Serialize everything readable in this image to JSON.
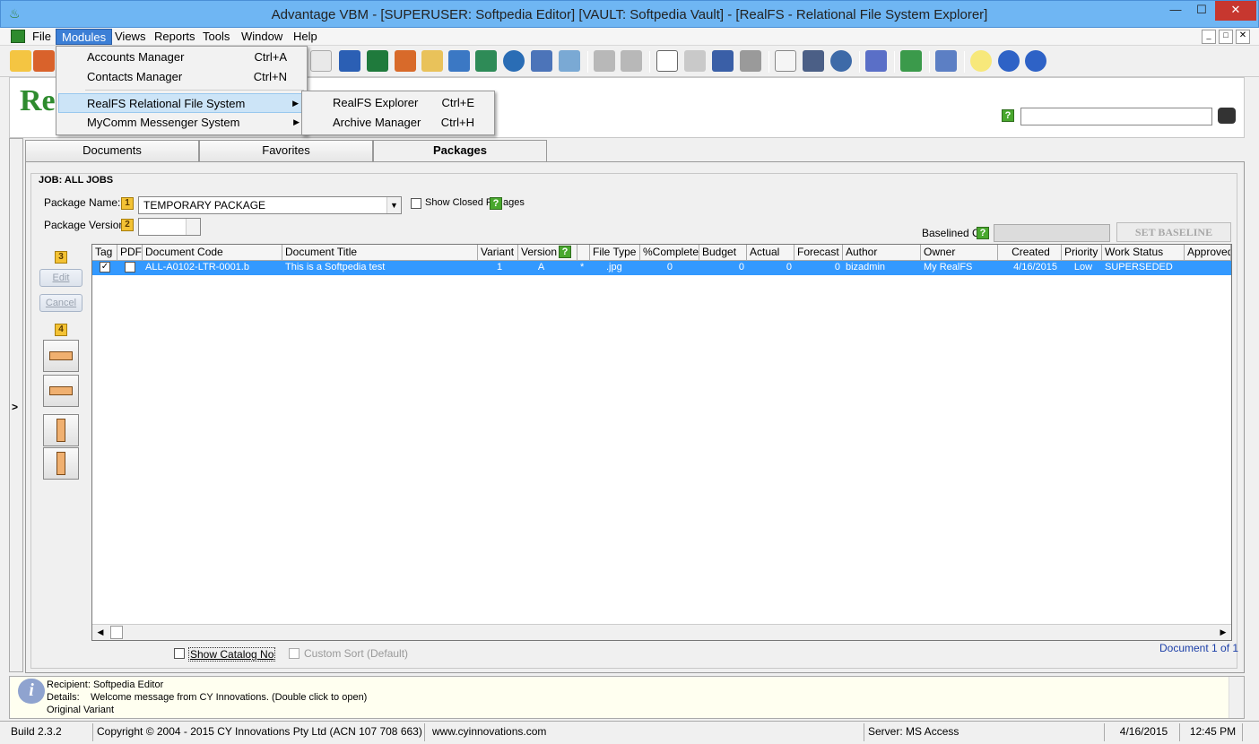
{
  "window": {
    "title": "Advantage VBM - [SUPERUSER: Softpedia Editor]  [VAULT: Softpedia Vault] - [RealFS - Relational File System Explorer]",
    "minimize": "—",
    "maximize": "☐",
    "close": "✕"
  },
  "menubar": [
    "File",
    "Modules",
    "Views",
    "Reports",
    "Tools",
    "Window",
    "Help"
  ],
  "modules_menu": {
    "items": [
      {
        "label": "Accounts Manager",
        "shortcut": "Ctrl+A"
      },
      {
        "label": "Contacts Manager",
        "shortcut": "Ctrl+N"
      },
      {
        "label": "RealFS Relational File System",
        "shortcut": ""
      },
      {
        "label": "MyComm Messenger System",
        "shortcut": ""
      }
    ]
  },
  "realfs_submenu": {
    "items": [
      {
        "label": "RealFS Explorer",
        "shortcut": "Ctrl+E"
      },
      {
        "label": "Archive Manager",
        "shortcut": "Ctrl+H"
      }
    ]
  },
  "header": {
    "logo": "Re",
    "search_value": ""
  },
  "tabs": [
    "Documents",
    "Favorites",
    "Packages"
  ],
  "job_label": "JOB: ALL JOBS",
  "package": {
    "name_label": "Package Name:",
    "name_value": "TEMPORARY PACKAGE",
    "version_label": "Package Version",
    "show_closed_a": "Show Closed P",
    "show_closed_b": "ages",
    "baselined_label": "Baselined C",
    "set_baseline": "SET BASELINE"
  },
  "markers": {
    "m1": "1",
    "m2": "2",
    "m3": "3",
    "m4": "4"
  },
  "side_buttons": {
    "edit": "Edit",
    "cancel": "Cancel"
  },
  "grid": {
    "headers": [
      "Tag",
      "PDF",
      "Document Code",
      "Document Title",
      "Variant",
      "Version",
      "",
      "File Type",
      "%Complete",
      "Budget",
      "Actual",
      "Forecast",
      "Author",
      "Owner",
      "Created",
      "Priority",
      "Work Status",
      "Approved"
    ],
    "row": [
      "",
      "",
      "ALL-A0102-LTR-0001.b",
      "This is a Softpedia test",
      "1",
      "A",
      "*",
      ".jpg",
      "0",
      "0",
      "0",
      "0",
      "bizadmin",
      "My RealFS",
      "4/16/2015",
      "Low",
      "SUPERSEDED",
      ""
    ]
  },
  "footer": {
    "show_catalog": "Show Catalog No",
    "custom_sort": "Custom Sort (Default)",
    "doc_count": "Document 1 of 1"
  },
  "message": {
    "line1": "Recipient: Softpedia Editor",
    "line2_label": "Details:",
    "line2_value": "Welcome message from CY Innovations. (Double click to open)",
    "line3": "Original Variant"
  },
  "status": {
    "build": "Build 2.3.2",
    "copyright": "Copyright © 2004 - 2015 CY Innovations Pty Ltd  (ACN 107 708 663)",
    "website": "www.cyinnovations.com",
    "server": "Server: MS Access",
    "date": "4/16/2015",
    "time": "12:45 PM"
  },
  "colors": {
    "selected_row": "#3399ff",
    "title_bar": "#6fb6f3",
    "menu_highlight": "#3c7fd6"
  },
  "left_toggle": ">"
}
